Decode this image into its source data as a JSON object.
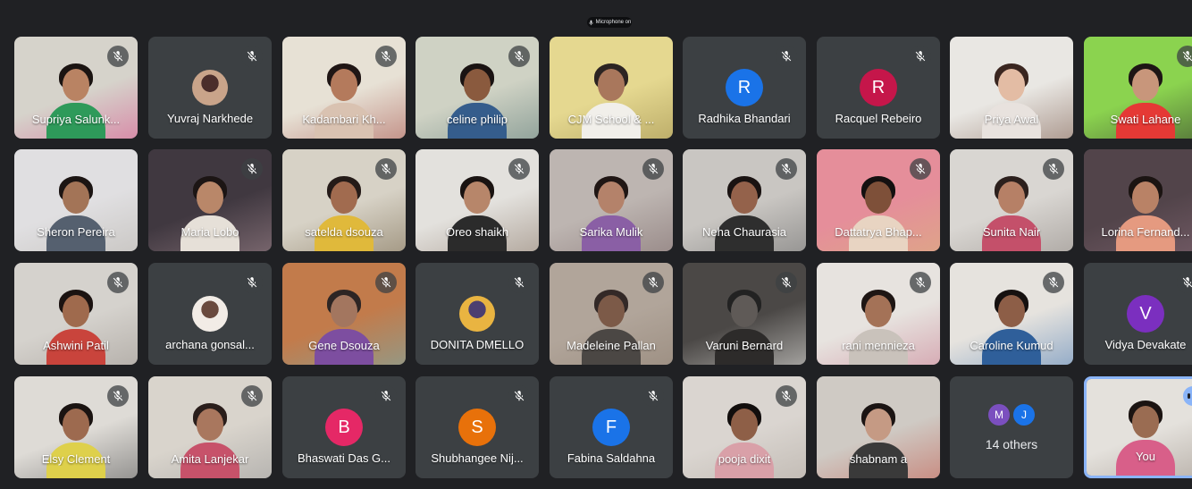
{
  "meeting": {
    "top_pill_text": "Microphone on"
  },
  "colors": {
    "background": "#202124",
    "tile": "#3c4043",
    "self_border": "#8ab4f8"
  },
  "participants": [
    {
      "name": "Supriya Salunk...",
      "kind": "video",
      "muted": true,
      "bg": "#d6d3cb",
      "skin": "#b98363",
      "hair": "#1b1412",
      "shirt": "#2e9a5a",
      "accent": "#d8508b"
    },
    {
      "name": "Yuvraj Narkhede",
      "kind": "photo",
      "muted": true,
      "photo_a": "#c9a48a",
      "photo_b": "#4a2d2b"
    },
    {
      "name": "Kadambari Kh...",
      "kind": "video",
      "muted": true,
      "bg": "#e7e1d5",
      "skin": "#b47a5c",
      "hair": "#201615",
      "shirt": "#d9c2b1",
      "accent": "#a6514a"
    },
    {
      "name": "celine philip",
      "kind": "video",
      "muted": true,
      "bg": "#cfd2c4",
      "skin": "#8a5a3e",
      "hair": "#1a1312",
      "shirt": "#355d8c",
      "accent": "#5d7b78"
    },
    {
      "name": "CJM School & ...",
      "kind": "video",
      "muted": false,
      "bg": "#e5d890",
      "skin": "#a9775c",
      "hair": "#2c2422",
      "shirt": "#f1efea",
      "accent": "#9b8a4a"
    },
    {
      "name": "Radhika Bhandari",
      "kind": "letter",
      "muted": true,
      "letter": "R",
      "avatar_color": "#1a73e8"
    },
    {
      "name": "Racquel Rebeiro",
      "kind": "letter",
      "muted": true,
      "letter": "R",
      "avatar_color": "#c5164a"
    },
    {
      "name": "Priya Awal",
      "kind": "video",
      "muted": false,
      "bg": "#e9e7e3",
      "skin": "#e3bca4",
      "hair": "#3a2620",
      "shirt": "#e8e2de",
      "accent": "#7b5a4b"
    },
    {
      "name": "Swati Lahane",
      "kind": "video",
      "muted": true,
      "bg": "#8bd34f",
      "skin": "#c8967b",
      "hair": "#1e1615",
      "shirt": "#e53935",
      "accent": "#2a2a2a"
    },
    {
      "name": "Sheron Pereira",
      "kind": "video",
      "muted": false,
      "bg": "#e0dfe1",
      "skin": "#a37457",
      "hair": "#1c1513",
      "shirt": "#55606f",
      "accent": "#b8b4ad"
    },
    {
      "name": "Maria Lobo",
      "kind": "video",
      "muted": true,
      "bg": "#403840",
      "skin": "#b98769",
      "hair": "#1c1514",
      "shirt": "#e6e0d8",
      "accent": "#a68b92"
    },
    {
      "name": "satelda dsouza",
      "kind": "video",
      "muted": true,
      "bg": "#d7d2c6",
      "skin": "#a16b4f",
      "hair": "#251b18",
      "shirt": "#e0b93b",
      "accent": "#7a6a4f"
    },
    {
      "name": "Oreo shaikh",
      "kind": "video",
      "muted": true,
      "bg": "#e3e1dd",
      "skin": "#b7866a",
      "hair": "#1a1311",
      "shirt": "#2b2b2b",
      "accent": "#8c7a6b"
    },
    {
      "name": "Sarika Mulik",
      "kind": "video",
      "muted": true,
      "bg": "#bdb5b1",
      "skin": "#b4826a",
      "hair": "#201614",
      "shirt": "#8a5fa5",
      "accent": "#7d6a6a"
    },
    {
      "name": "Neha Chaurasia",
      "kind": "video",
      "muted": true,
      "bg": "#c9c6c2",
      "skin": "#94624b",
      "hair": "#1a1312",
      "shirt": "#2e2e2e",
      "accent": "#6c6c6c"
    },
    {
      "name": "Dattatrya Bhap...",
      "kind": "video",
      "muted": true,
      "bg": "#e58e9a",
      "skin": "#7e5039",
      "hair": "#141010",
      "shirt": "#e8d4c2",
      "accent": "#d8b67a"
    },
    {
      "name": "Sunita Nair",
      "kind": "video",
      "muted": true,
      "bg": "#d9d6d2",
      "skin": "#b68066",
      "hair": "#2c201d",
      "shirt": "#c4506a",
      "accent": "#8e8782"
    },
    {
      "name": "Lorina Fernand...",
      "kind": "video",
      "muted": false,
      "bg": "#52444a",
      "skin": "#b98266",
      "hair": "#1b1412",
      "shirt": "#e59a80",
      "accent": "#8a6b79"
    },
    {
      "name": "Ashwini Patil",
      "kind": "video",
      "muted": true,
      "bg": "#d5d2cd",
      "skin": "#9f6a4d",
      "hair": "#1b1311",
      "shirt": "#c9443c",
      "accent": "#9c958f"
    },
    {
      "name": "archana gonsal...",
      "kind": "photo",
      "muted": true,
      "photo_a": "#f2ece6",
      "photo_b": "#6a4a3e"
    },
    {
      "name": "Gene Dsouza",
      "kind": "video",
      "muted": true,
      "bg": "#c27b4b",
      "skin": "#a3765f",
      "hair": "#2d2524",
      "shirt": "#7d4ea0",
      "accent": "#6fb0b3"
    },
    {
      "name": "DONITA DMELLO",
      "kind": "photo",
      "muted": true,
      "photo_a": "#e9b441",
      "photo_b": "#4c3f70"
    },
    {
      "name": "Madeleine Pallan",
      "kind": "video",
      "muted": true,
      "bg": "#b1a59a",
      "skin": "#7c5a48",
      "hair": "#332927",
      "shirt": "#4b4744",
      "accent": "#8e7f71"
    },
    {
      "name": "Varuni Bernard",
      "kind": "video",
      "muted": true,
      "bg": "#4b4846",
      "skin": "#5f5a57",
      "hair": "#222",
      "shirt": "#2d2b2a",
      "accent": "#efeeea"
    },
    {
      "name": "rani mennieza",
      "kind": "video",
      "muted": true,
      "bg": "#e7e3df",
      "skin": "#a47257",
      "hair": "#1e1614",
      "shirt": "#c9c2bb",
      "accent": "#c87c90"
    },
    {
      "name": "Caroline Kumud",
      "kind": "video",
      "muted": true,
      "bg": "#e6e3de",
      "skin": "#8d5e47",
      "hair": "#161110",
      "shirt": "#2f5f9a",
      "accent": "#4e7db5"
    },
    {
      "name": "Vidya Devakate",
      "kind": "letter",
      "muted": true,
      "letter": "V",
      "avatar_color": "#7b2fbf"
    },
    {
      "name": "Elsy Clement",
      "kind": "video",
      "muted": true,
      "bg": "#dedbd6",
      "skin": "#9d6a4f",
      "hair": "#1a1311",
      "shirt": "#ded04b",
      "accent": "#555"
    },
    {
      "name": "Amita Lanjekar",
      "kind": "video",
      "muted": true,
      "bg": "#d9d4cc",
      "skin": "#a9775e",
      "hair": "#2a1e1b",
      "shirt": "#c7526a",
      "accent": "#999"
    },
    {
      "name": "Bhaswati Das G...",
      "kind": "letter",
      "muted": true,
      "letter": "B",
      "avatar_color": "#e52866"
    },
    {
      "name": "Shubhangee Nij...",
      "kind": "letter",
      "muted": true,
      "letter": "S",
      "avatar_color": "#e8710a"
    },
    {
      "name": "Fabina Saldahna",
      "kind": "letter",
      "muted": true,
      "letter": "F",
      "avatar_color": "#1a73e8"
    },
    {
      "name": "pooja dixit",
      "kind": "video",
      "muted": true,
      "bg": "#dad5d0",
      "skin": "#8e5f47",
      "hair": "#120e0d",
      "shirt": "#d9a0a8",
      "accent": "#b0a8a0"
    },
    {
      "name": "shabnam a",
      "kind": "video",
      "muted": false,
      "bg": "#cfcac4",
      "skin": "#c59a84",
      "hair": "#1b1413",
      "shirt": "#3a3a3a",
      "accent": "#c25a4c"
    },
    {
      "name": "14 others",
      "kind": "others",
      "muted": false,
      "avatars": [
        {
          "letter": "M",
          "color": "#7b4fbf"
        },
        {
          "letter": "J",
          "color": "#1a73e8"
        }
      ]
    },
    {
      "name": "You",
      "kind": "self",
      "muted": false,
      "bg": "#e4e1dc",
      "skin": "#9a6c52",
      "hair": "#1b1412",
      "shirt": "#d85f89",
      "accent": "#9a8f86"
    }
  ]
}
